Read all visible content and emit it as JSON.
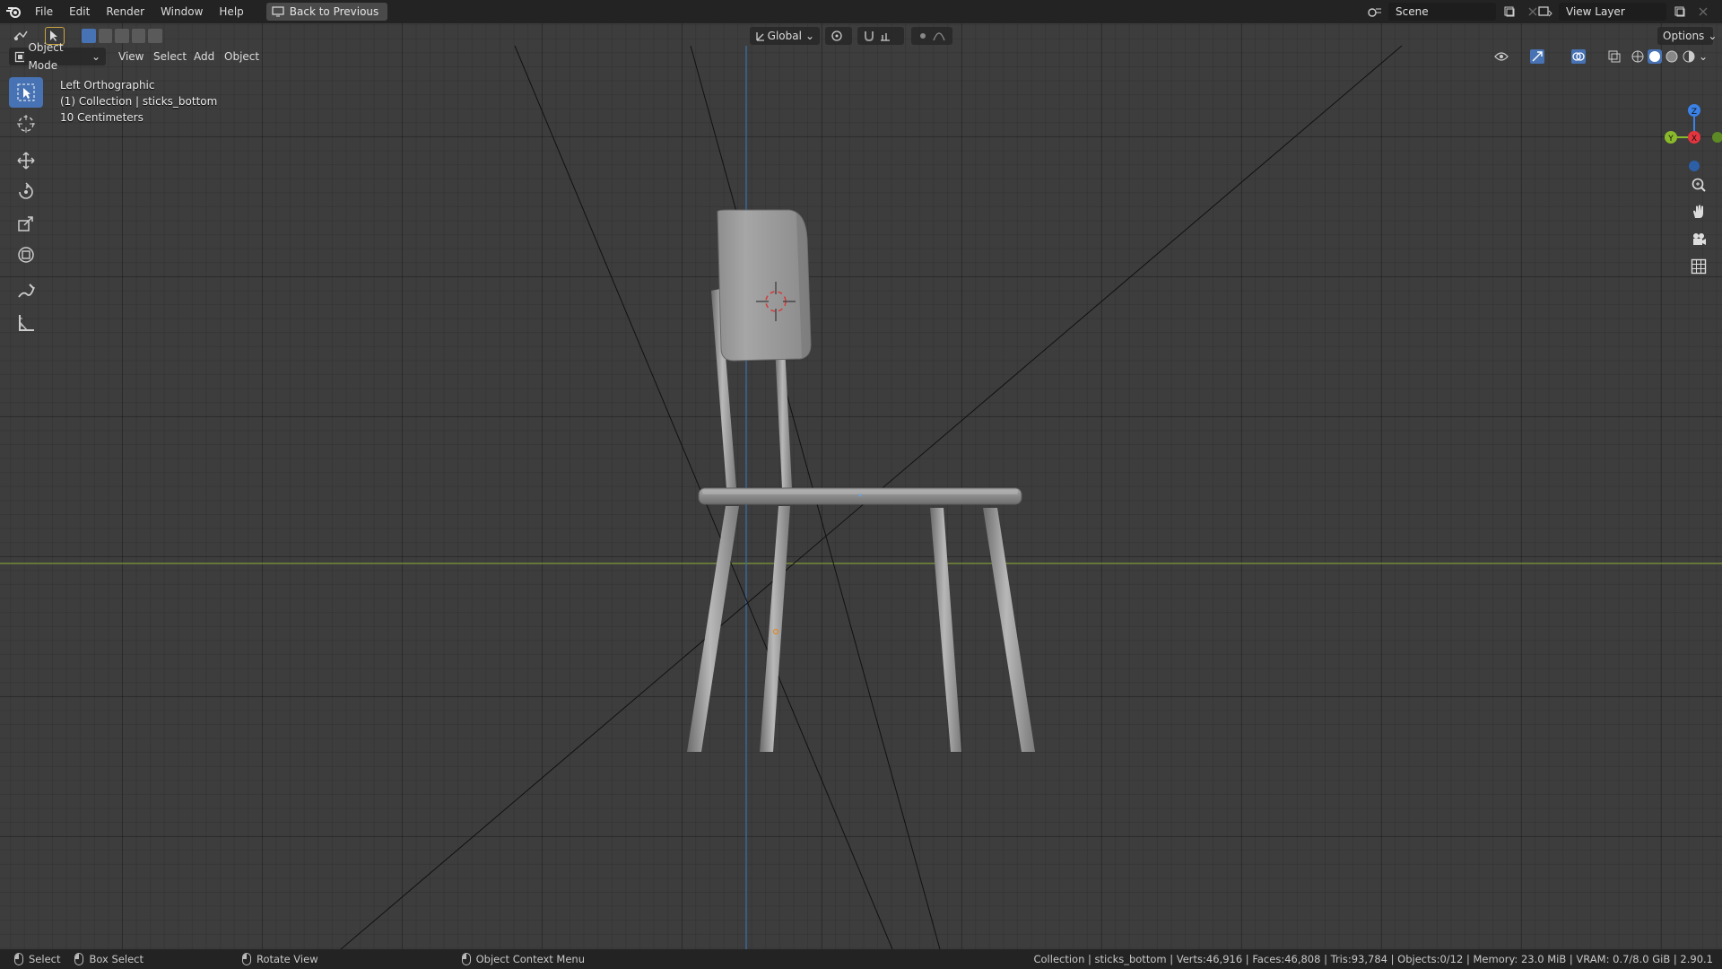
{
  "topbar": {
    "menus": [
      "File",
      "Edit",
      "Render",
      "Window",
      "Help"
    ],
    "back_button": "Back to Previous",
    "scene_name": "Scene",
    "view_layer": "View Layer"
  },
  "viewport_header": {
    "mode": "Object Mode",
    "menus": [
      "View",
      "Select",
      "Add",
      "Object"
    ],
    "transform_orientation": "Global",
    "options": "Options"
  },
  "overlay": {
    "view_name": "Left Orthographic",
    "collection": "(1) Collection | sticks_bottom",
    "scale": "10 Centimeters"
  },
  "toolbar": {
    "tools": [
      "select-box-icon",
      "cursor-icon",
      "move-icon",
      "rotate-icon",
      "scale-icon",
      "transform-icon",
      "annotate-icon",
      "measure-icon"
    ]
  },
  "gizmo": {
    "z_label": "Z",
    "y_label": "Y",
    "x_label": "X",
    "colors": {
      "x": "#e4353f",
      "y": "#8ab92c",
      "z": "#3a82e8"
    }
  },
  "statusbar": {
    "select": "Select",
    "box_select": "Box Select",
    "rotate_view": "Rotate View",
    "context_menu": "Object Context Menu",
    "stats": "Collection | sticks_bottom | Verts:46,916 | Faces:46,808 | Tris:93,784 | Objects:0/12 | Memory: 23.0 MiB | VRAM: 0.7/8.0 GiB | 2.90.1"
  }
}
